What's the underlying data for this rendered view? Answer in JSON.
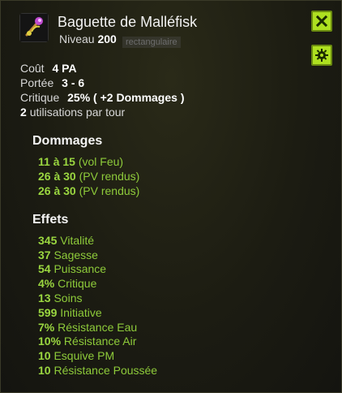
{
  "item": {
    "name": "Baguette de Malléfisk",
    "level_label": "Niveau",
    "level": "200",
    "ghost_text": "rectangulaire"
  },
  "buttons": {
    "close_icon": "close-icon",
    "settings_icon": "gear-icon"
  },
  "stats": {
    "cost_label": "Coût",
    "cost_value": "4 PA",
    "range_label": "Portée",
    "range_value": "3 - 6",
    "crit_label": "Critique",
    "crit_value": "25% ( +2 Dommages )",
    "uses_value": "2",
    "uses_label": "utilisations par tour"
  },
  "damages": {
    "title": "Dommages",
    "lines": [
      {
        "value": "11 à 15",
        "text": "(vol Feu)"
      },
      {
        "value": "26 à 30",
        "text": "(PV rendus)"
      },
      {
        "value": "26 à 30",
        "text": "(PV rendus)"
      }
    ]
  },
  "effects": {
    "title": "Effets",
    "lines": [
      {
        "value": "345",
        "text": "Vitalité"
      },
      {
        "value": "37",
        "text": "Sagesse"
      },
      {
        "value": "54",
        "text": "Puissance"
      },
      {
        "value": "4%",
        "text": "Critique"
      },
      {
        "value": "13",
        "text": "Soins"
      },
      {
        "value": "599",
        "text": "Initiative"
      },
      {
        "value": "7%",
        "text": "Résistance Eau"
      },
      {
        "value": "10%",
        "text": "Résistance Air"
      },
      {
        "value": "10",
        "text": "Esquive PM"
      },
      {
        "value": "10",
        "text": "Résistance Poussée"
      }
    ]
  },
  "colors": {
    "accent_green": "#aee020",
    "effect_text": "#8ecb3a"
  }
}
